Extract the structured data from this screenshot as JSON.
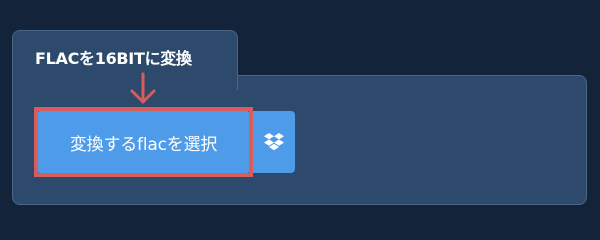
{
  "tab": {
    "title": "FLACを16BITに変換"
  },
  "actions": {
    "select_label": "変換するflacを選択",
    "dropbox_icon": "dropbox-icon"
  },
  "colors": {
    "background": "#13243a",
    "panel": "#2d4a6c",
    "panel_border": "#4b6788",
    "button": "#4e9bea",
    "highlight": "#d95c5c"
  }
}
